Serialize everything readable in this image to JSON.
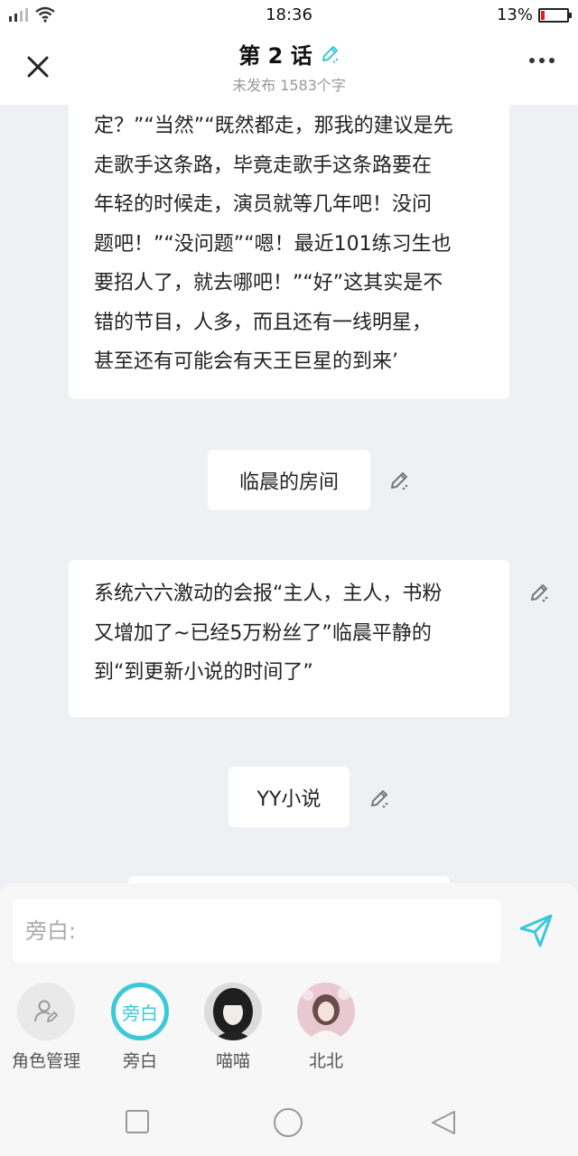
{
  "status": {
    "time": "18:36",
    "battery": "13%",
    "battery_level": 0.13
  },
  "header": {
    "title": "第 2 话",
    "subtitle": "未发布 1583个字",
    "accent": "#3cc8d8"
  },
  "messages": {
    "card1_lines": [
      "定？”“当然”“既然都走，那我的建议是先",
      "走歌手这条路，毕竟走歌手这条路要在",
      "年轻的时候走，演员就等几年吧！没问",
      "题吧！”“没问题”“嗯！最近101练习生也",
      "要招人了，就去哪吧！”“好”这其实是不",
      "错的节目，人多，而且还有一线明星，",
      "甚至还有可能会有天王巨星的到来’"
    ],
    "scene1": "临晨的房间",
    "card2_lines": [
      "系统六六激动的会报“主人，主人，书粉",
      "又增加了~已经5万粉丝了”临晨平静的",
      "到“到更新小说的时间了”"
    ],
    "scene2": "YY小说"
  },
  "composer": {
    "placeholder": "旁白:"
  },
  "roles": [
    {
      "label": "角色管理",
      "icon": "person-edit-icon"
    },
    {
      "label": "旁白",
      "icon_text": "旁白"
    },
    {
      "label": "喵喵",
      "icon": "avatar-dark-hair"
    },
    {
      "label": "北北",
      "icon": "avatar-pink"
    }
  ],
  "icons": [
    "close-icon",
    "more-icon",
    "pencil-icon",
    "send-icon",
    "square-icon",
    "circle-icon",
    "back-triangle-icon"
  ]
}
